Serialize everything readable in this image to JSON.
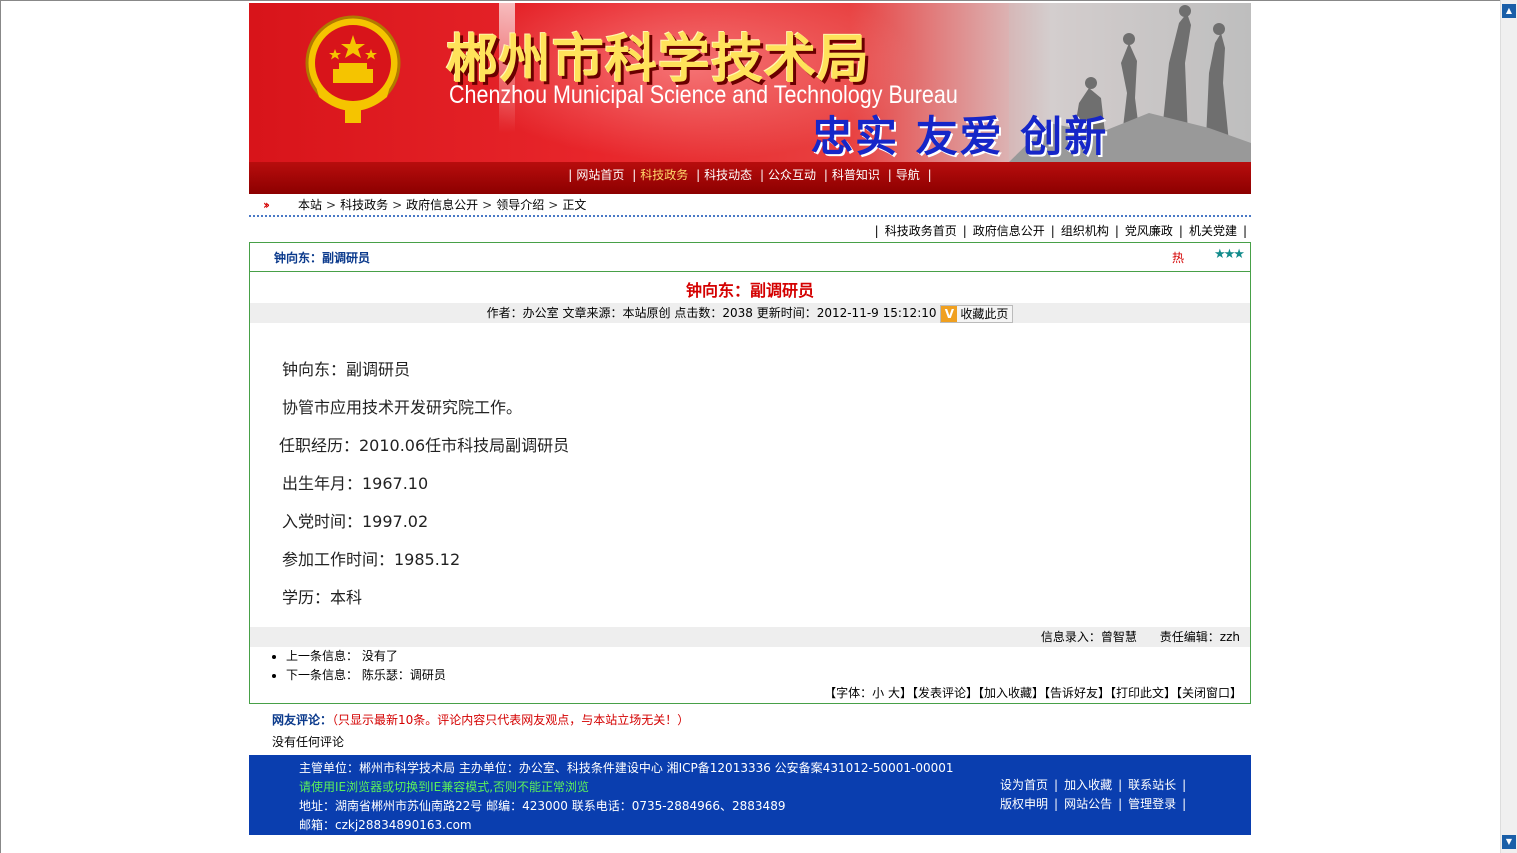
{
  "header": {
    "title_cn": "郴州市科学技术局",
    "title_en": "Chenzhou Municipal  Science and Technology Bureau",
    "slogan": "忠实 友爱 创新"
  },
  "nav": {
    "items": [
      "网站首页",
      "科技政务",
      "科技动态",
      "公众互动",
      "科普知识",
      "导航"
    ],
    "active": "科技政务"
  },
  "breadcrumb": {
    "arrow": "»",
    "items": [
      "本站",
      "科技政务",
      "政府信息公开",
      "领导介绍",
      "正文"
    ]
  },
  "subnav": {
    "items": [
      "科技政务首页",
      "政府信息公开",
      "组织机构",
      "党风廉政",
      "机关党建"
    ]
  },
  "article": {
    "head_title": "钟向东：副调研员",
    "hot_label": "热",
    "stars": "★★★",
    "title": "钟向东：副调研员",
    "meta": {
      "author": "作者：办公室",
      "source": "文章来源：本站原创",
      "clicks": "点击数：2038",
      "updated": "更新时间：2012-11-9 15:12:10",
      "fav_icon": "V",
      "fav_label": "收藏此页"
    },
    "body": [
      "钟向东：副调研员",
      "协管市应用技术开发研究院工作。",
      "任职经历：2010.06任市科技局副调研员",
      "出生年月：1967.10",
      "入党时间：1997.02",
      "参加工作时间：1985.12",
      "学历：本科"
    ],
    "entry": "信息录入：曾智慧",
    "editor": "责任编辑：zzh",
    "prev_label": "上一条信息：",
    "prev_value": "没有了",
    "next_label": "下一条信息：",
    "next_value": "陈乐瑟：调研员",
    "tools": "【字体：小 大】【发表评论】【加入收藏】【告诉好友】【打印此文】【关闭窗口】"
  },
  "comments": {
    "title": "网友评论：",
    "note": "（只显示最新10条。评论内容只代表网友观点，与本站立场无关！）",
    "empty": "没有任何评论"
  },
  "footer": {
    "line1": "主管单位：郴州市科学技术局 主办单位：办公室、科技条件建设中心 湘ICP备12013336 公安备案431012-50001-00001",
    "warning": "请使用IE浏览器或切换到IE兼容模式,否则不能正常浏览",
    "address": "地址：湖南省郴州市苏仙南路22号 邮编：423000 联系电话：0735-2884966、2883489",
    "email": "邮箱：czkj28834890163.com",
    "links_row1": [
      "设为首页",
      "加入收藏",
      "联系站长"
    ],
    "links_row2": [
      "版权申明",
      "网站公告",
      "管理登录"
    ]
  },
  "colors": {
    "banner_red": "#e8262b",
    "nav_red": "#9a0000",
    "title_red": "#d40000",
    "link_blue": "#0b3a8c",
    "footer_blue": "#0a3eaf",
    "border_green": "#48a048",
    "warning_green": "#5cf05c"
  },
  "icons": [
    "national-emblem-icon",
    "double-arrow-icon",
    "star-icon",
    "bookmark-icon",
    "scroll-up-icon",
    "scroll-down-icon"
  ]
}
